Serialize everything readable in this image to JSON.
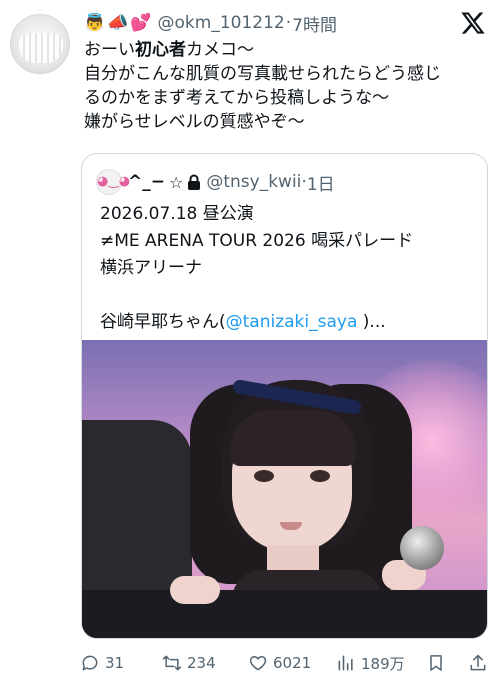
{
  "post": {
    "emojis": [
      "👼",
      "📣",
      "💕"
    ],
    "handle": "@okm_101212",
    "separator": "·",
    "time": "7時間",
    "text": {
      "line1_a": "おーい",
      "line1_bold": "初心者",
      "line1_b": "カメコ〜",
      "line2": "自分がこんな肌質の写真載せられたらどう感じ",
      "line3": "るのかをまず考えてから投稿しような〜",
      "line4": "嫌がらせレベルの質感やぞ〜"
    }
  },
  "quoted": {
    "name": "^_−",
    "star": "☆",
    "handle": "@tnsy_kwii",
    "separator": "·",
    "time": "1日",
    "lines": [
      "2026.07.18 昼公演",
      "≠ME ARENA TOUR 2026 喝采パレード",
      "横浜アリーナ",
      ""
    ],
    "last_line": {
      "prefix": "谷崎早耶ちゃん(",
      "mention": "@tanizaki_saya",
      "suffix": " )..."
    }
  },
  "actions": {
    "replies": "31",
    "reposts": "234",
    "likes": "6021",
    "views": "189万"
  },
  "icons": {
    "logo": "x-logo-icon",
    "lock": "lock-icon",
    "reply": "reply-icon",
    "repost": "repost-icon",
    "like": "heart-icon",
    "views": "views-icon",
    "bookmark": "bookmark-icon",
    "share": "share-icon"
  },
  "colors": {
    "text": "#0f1419",
    "secondary": "#536471",
    "link": "#1d9bf0",
    "border": "#cfd9de"
  }
}
